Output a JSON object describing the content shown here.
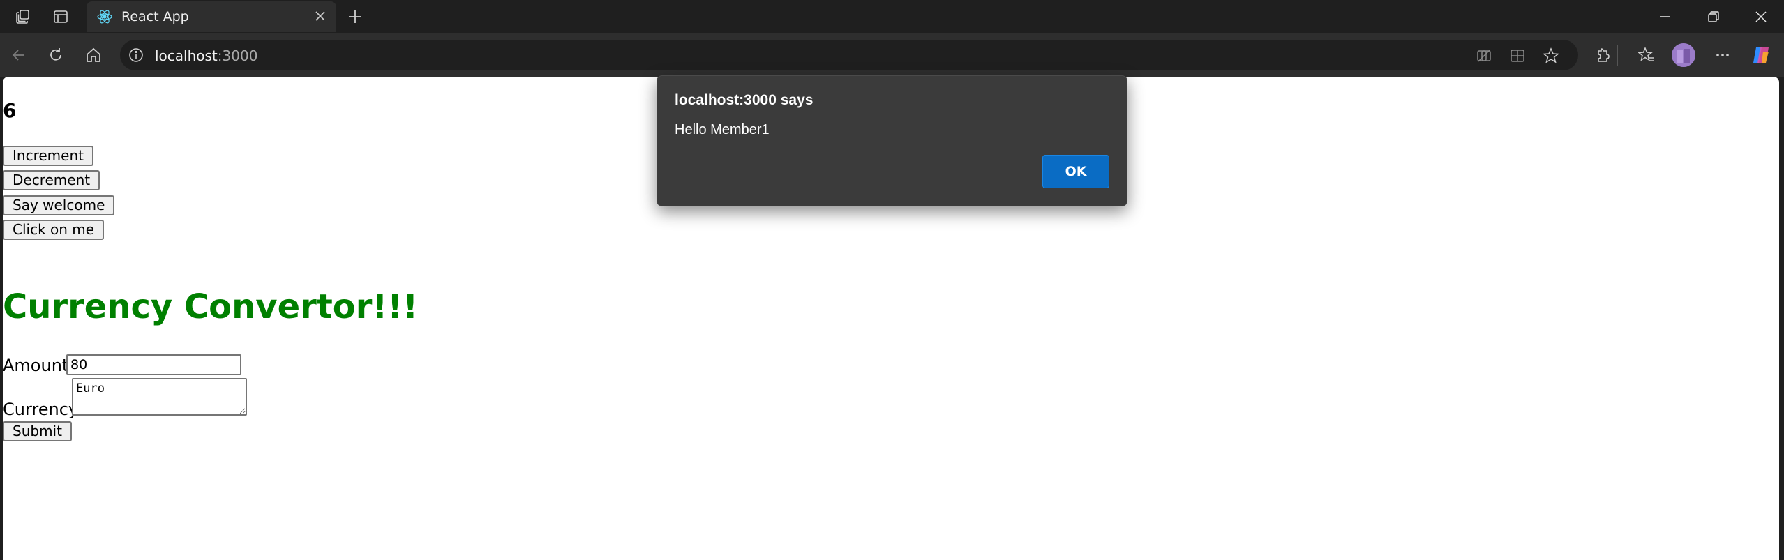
{
  "browser": {
    "tab_title": "React App",
    "url_host": "localhost",
    "url_port": ":3000",
    "icons": {
      "workspaces": "workspaces-icon",
      "tab_actions": "tab-actions-icon",
      "favicon": "react-logo-icon",
      "tab_close": "close-icon",
      "new_tab": "plus-icon",
      "minimize": "minimize-icon",
      "restore": "restore-icon",
      "window_close": "close-icon",
      "back": "back-arrow-icon",
      "refresh": "refresh-icon",
      "home": "home-icon",
      "site_info": "info-icon",
      "read_aloud": "read-aloud-icon",
      "split_screen": "split-screen-icon",
      "favorite": "star-icon",
      "extensions": "puzzle-icon",
      "favorites": "favorites-icon",
      "profile": "avatar",
      "more": "more-dots-icon",
      "copilot": "copilot-icon"
    }
  },
  "page": {
    "count": "6",
    "buttons": {
      "increment": "Increment",
      "decrement": "Decrement",
      "say_welcome": "Say welcome",
      "click_on_me": "Click on me"
    },
    "heading": "Currency Convertor!!!",
    "amount_label": "Amount:",
    "amount_value": "80",
    "currency_label": "Currency:",
    "currency_value": "Euro",
    "submit": "Submit"
  },
  "dialog": {
    "title": "localhost:3000 says",
    "message": "Hello Member1",
    "ok": "OK"
  },
  "colors": {
    "heading": "#008000",
    "ok_button": "#0a6cc4",
    "dialog_bg": "#3b3b3b",
    "chrome_bg": "#1f1f1f"
  }
}
